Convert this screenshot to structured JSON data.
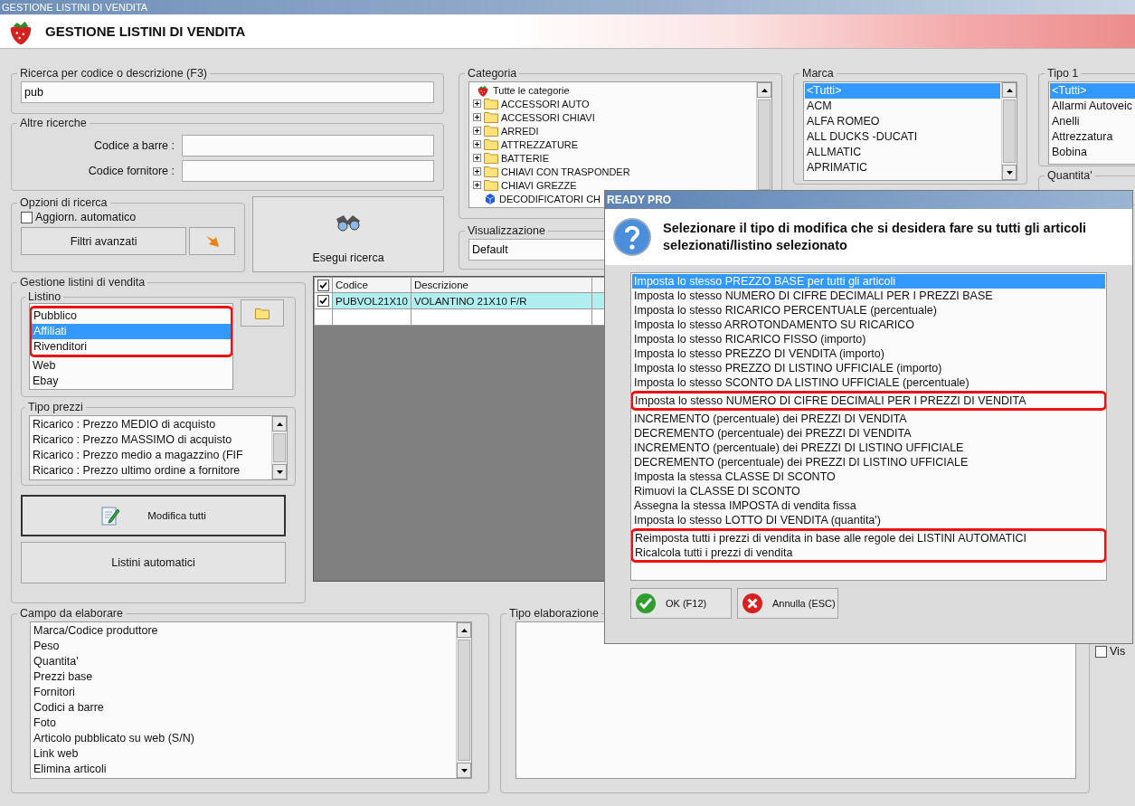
{
  "window": {
    "title": "GESTIONE LISTINI DI VENDITA"
  },
  "header": {
    "title": "GESTIONE LISTINI DI VENDITA"
  },
  "search": {
    "label": "Ricerca per codice o descrizione (F3)",
    "value": "pub"
  },
  "other_searches": {
    "label": "Altre ricerche",
    "fields": [
      {
        "label": "Codice a barre :"
      },
      {
        "label": "Codice fornitore :"
      }
    ]
  },
  "search_options": {
    "label": "Opzioni di ricerca",
    "auto_update": {
      "label": "Aggiorn. automatico",
      "checked": false
    },
    "advanced_filters": "Filtri avanzati"
  },
  "run_search": "Esegui ricerca",
  "category": {
    "label": "Categoria",
    "items": [
      {
        "label": "Tutte le categorie",
        "kind": "root"
      },
      {
        "label": "ACCESSORI AUTO",
        "kind": "folder"
      },
      {
        "label": "ACCESSORI CHIAVI",
        "kind": "folder"
      },
      {
        "label": "ARREDI",
        "kind": "folder"
      },
      {
        "label": "ATTREZZATURE",
        "kind": "folder"
      },
      {
        "label": "BATTERIE",
        "kind": "folder"
      },
      {
        "label": "CHIAVI CON TRASPONDER",
        "kind": "folder"
      },
      {
        "label": "CHIAVI GREZZE",
        "kind": "folder"
      },
      {
        "label": "DECODIFICATORI CH",
        "kind": "leaf"
      }
    ]
  },
  "view": {
    "label": "Visualizzazione",
    "value": "Default"
  },
  "brand": {
    "label": "Marca",
    "items": [
      {
        "label": "<Tutti>",
        "selected": true
      },
      {
        "label": "ACM",
        "selected": false
      },
      {
        "label": "ALFA ROMEO",
        "selected": false
      },
      {
        "label": "ALL DUCKS -DUCATI",
        "selected": false
      },
      {
        "label": "ALLMATIC",
        "selected": false
      },
      {
        "label": "APRIMATIC",
        "selected": false
      }
    ]
  },
  "type1": {
    "label": "Tipo 1",
    "items": [
      {
        "label": "<Tutti>",
        "selected": true
      },
      {
        "label": "Allarmi Autoveic",
        "selected": false
      },
      {
        "label": "Anelli",
        "selected": false
      },
      {
        "label": "Attrezzatura",
        "selected": false
      },
      {
        "label": "Bobina",
        "selected": false
      }
    ]
  },
  "quantity": {
    "label": "Quantita'"
  },
  "price_lists": {
    "label": "Gestione listini di vendita",
    "list": {
      "label": "Listino",
      "items": [
        {
          "label": "Pubblico",
          "selected": false,
          "highlighted": true
        },
        {
          "label": "Affiliati",
          "selected": true,
          "highlighted": true
        },
        {
          "label": "Rivenditori",
          "selected": false,
          "highlighted": true
        },
        {
          "label": "Web",
          "selected": false,
          "highlighted": false
        },
        {
          "label": "Ebay",
          "selected": false,
          "highlighted": false
        }
      ]
    },
    "price_types": {
      "label": "Tipo prezzi",
      "items": [
        {
          "label": "Ricarico : Prezzo MEDIO di acquisto",
          "selected": false
        },
        {
          "label": "Ricarico : Prezzo MASSIMO di acquisto",
          "selected": false
        },
        {
          "label": "Ricarico : Prezzo medio a magazzino (FIF",
          "selected": false
        },
        {
          "label": "Ricarico : Prezzo ultimo ordine a fornitore",
          "selected": false
        }
      ]
    },
    "edit_all": "Modifica tutti",
    "auto_lists": "Listini automatici"
  },
  "grid": {
    "header_checked": true,
    "columns": [
      "Codice",
      "Descrizione"
    ],
    "rows": [
      {
        "checked": true,
        "cells": [
          "PUBVOL21X10",
          "VOLANTINO 21X10 F/R"
        ]
      }
    ]
  },
  "field_to_process": {
    "label": "Campo da elaborare",
    "items": [
      {
        "label": "Marca/Codice produttore",
        "selected": false
      },
      {
        "label": "Peso",
        "selected": false
      },
      {
        "label": "Quantita'",
        "selected": false
      },
      {
        "label": "Prezzi base",
        "selected": false
      },
      {
        "label": "Fornitori",
        "selected": false
      },
      {
        "label": "Codici a barre",
        "selected": false
      },
      {
        "label": "Foto",
        "selected": false
      },
      {
        "label": "Articolo pubblicato su web (S/N)",
        "selected": false
      },
      {
        "label": "Link web",
        "selected": false
      },
      {
        "label": "Elimina articoli",
        "selected": false
      }
    ]
  },
  "process_type": {
    "label": "Tipo elaborazione"
  },
  "side_checkbox": {
    "label": "Vis",
    "checked": false
  },
  "dialog": {
    "title": "READY PRO",
    "message": "Selezionare il tipo di modifica che si desidera fare su tutti gli articoli selezionati/listino selezionato",
    "options": [
      {
        "label": "Imposta lo stesso PREZZO BASE per tutti gli articoli",
        "selected": true,
        "highlighted": false
      },
      {
        "label": "Imposta lo stesso NUMERO DI CIFRE DECIMALI PER I PREZZI BASE",
        "selected": false,
        "highlighted": false
      },
      {
        "label": "Imposta lo stesso RICARICO PERCENTUALE (percentuale)",
        "selected": false,
        "highlighted": false
      },
      {
        "label": "Imposta lo stesso ARROTONDAMENTO SU RICARICO",
        "selected": false,
        "highlighted": false
      },
      {
        "label": "Imposta lo stesso RICARICO FISSO (importo)",
        "selected": false,
        "highlighted": false
      },
      {
        "label": "Imposta lo stesso PREZZO DI VENDITA (importo)",
        "selected": false,
        "highlighted": false
      },
      {
        "label": "Imposta lo stesso PREZZO DI LISTINO UFFICIALE (importo)",
        "selected": false,
        "highlighted": false
      },
      {
        "label": "Imposta lo stesso SCONTO DA LISTINO UFFICIALE (percentuale)",
        "selected": false,
        "highlighted": false
      },
      {
        "label": "Imposta lo stesso NUMERO DI CIFRE DECIMALI PER I PREZZI DI VENDITA",
        "selected": false,
        "highlighted": true
      },
      {
        "label": "INCREMENTO (percentuale) dei PREZZI DI VENDITA",
        "selected": false,
        "highlighted": false
      },
      {
        "label": "DECREMENTO (percentuale) dei PREZZI DI VENDITA",
        "selected": false,
        "highlighted": false
      },
      {
        "label": "INCREMENTO (percentuale) dei PREZZI DI LISTINO UFFICIALE",
        "selected": false,
        "highlighted": false
      },
      {
        "label": "DECREMENTO (percentuale) dei PREZZI DI LISTINO UFFICIALE",
        "selected": false,
        "highlighted": false
      },
      {
        "label": "Imposta la stessa CLASSE DI SCONTO",
        "selected": false,
        "highlighted": false
      },
      {
        "label": "Rimuovi la CLASSE DI SCONTO",
        "selected": false,
        "highlighted": false
      },
      {
        "label": "Assegna la stessa IMPOSTA di vendita fissa",
        "selected": false,
        "highlighted": false
      },
      {
        "label": "Imposta lo stesso LOTTO DI VENDITA (quantita')",
        "selected": false,
        "highlighted": false
      },
      {
        "label": "Reimposta tutti i prezzi di vendita in base alle regole dei LISTINI AUTOMATICI",
        "selected": false,
        "highlighted": true
      },
      {
        "label": "Ricalcola tutti i prezzi di vendita",
        "selected": false,
        "highlighted": true
      }
    ],
    "buttons": [
      {
        "label": "OK (F12)",
        "kind": "ok"
      },
      {
        "label": "Annulla (ESC)",
        "kind": "cancel"
      }
    ]
  }
}
